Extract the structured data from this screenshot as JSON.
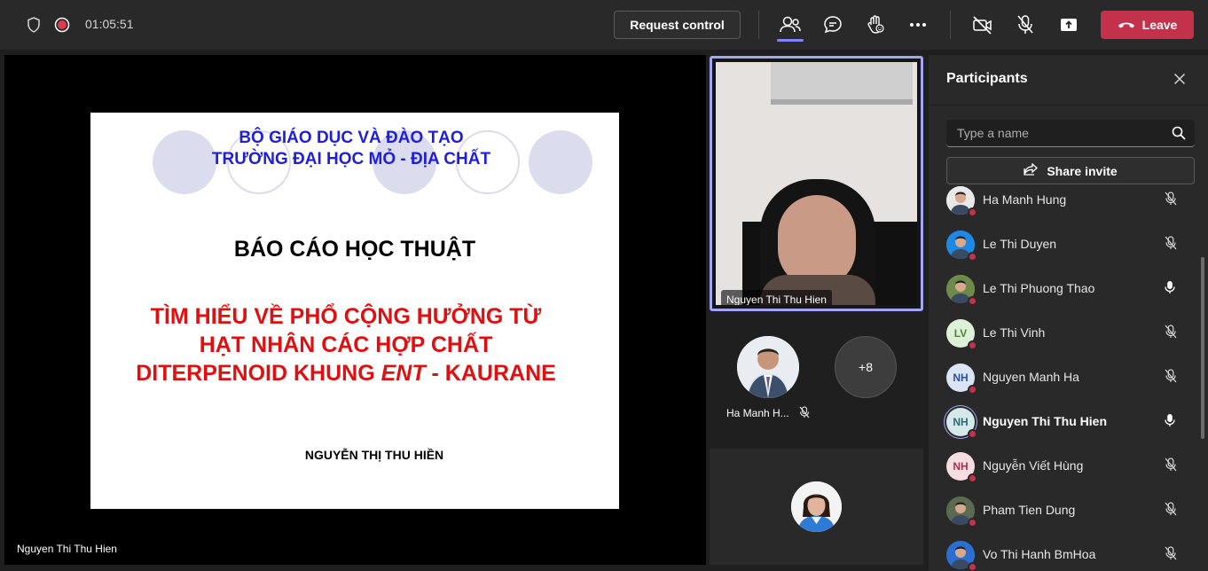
{
  "topbar": {
    "timer": "01:05:51",
    "request_control_label": "Request control",
    "leave_label": "Leave",
    "icons": [
      "shield-icon",
      "recording-icon",
      "people-icon",
      "chat-icon",
      "raise-hand-icon",
      "more-icon",
      "camera-off-icon",
      "mic-off-icon",
      "share-icon",
      "phone-icon"
    ]
  },
  "stage": {
    "presenter_name": "Nguyen Thi Thu Hien",
    "slide": {
      "institution_line1": "BỘ GIÁO DỤC VÀ ĐÀO TẠO",
      "institution_line2": "TRƯỜNG ĐẠI HỌC MỎ - ĐỊA CHẤT",
      "report_type": "BÁO CÁO HỌC THUẬT",
      "title_line1": "TÌM HIỂU VỀ PHỔ CỘNG HƯỞNG TỪ",
      "title_line2": "HẠT NHÂN CÁC HỢP CHẤT",
      "title_line3_pre": "DITERPENOID KHUNG ",
      "title_line3_italic": "ENT",
      "title_line3_post": " - KAURANE",
      "author": "NGUYỄN THỊ THU HIỀN"
    }
  },
  "video": {
    "speaker_name": "Nguyen Thi Thu Hien"
  },
  "tiles": {
    "participant_name": "Ha Manh H...",
    "more_count": "+8"
  },
  "panel": {
    "title": "Participants",
    "search_placeholder": "Type a name",
    "share_invite_label": "Share invite",
    "participants": [
      {
        "name": "Ha Manh Hung",
        "initials": "",
        "photo": true,
        "mic": "muted",
        "avatar_color": "#e8e8e8",
        "selected": false
      },
      {
        "name": "Le Thi Duyen",
        "initials": "",
        "photo": true,
        "mic": "muted",
        "avatar_color": "#1e88e5",
        "selected": false
      },
      {
        "name": "Le Thi Phuong Thao",
        "initials": "",
        "photo": true,
        "mic": "on",
        "avatar_color": "#6d8a4a",
        "selected": false
      },
      {
        "name": "Le Thi Vinh",
        "initials": "LV",
        "photo": false,
        "mic": "muted",
        "avatar_color": "#dff0d8",
        "text_color": "#4a8a2a",
        "selected": false
      },
      {
        "name": "Nguyen Manh Ha",
        "initials": "NH",
        "photo": false,
        "mic": "muted",
        "avatar_color": "#dbe4f5",
        "text_color": "#2c4f9e",
        "selected": false
      },
      {
        "name": "Nguyen Thi Thu Hien",
        "initials": "NH",
        "photo": false,
        "mic": "on",
        "avatar_color": "#d5e8ea",
        "text_color": "#2a6a75",
        "selected": true
      },
      {
        "name": "Nguyễn Viết Hùng",
        "initials": "NH",
        "photo": false,
        "mic": "muted",
        "avatar_color": "#f6dde2",
        "text_color": "#a8334e",
        "selected": false
      },
      {
        "name": "Pham Tien Dung",
        "initials": "",
        "photo": true,
        "mic": "muted",
        "avatar_color": "#5d6a52",
        "selected": false
      },
      {
        "name": "Vo Thi Hanh BmHoa",
        "initials": "",
        "photo": true,
        "mic": "muted",
        "avatar_color": "#2d6fd1",
        "selected": false
      }
    ]
  },
  "colors": {
    "accent": "#7f85f5",
    "leave": "#c4314b",
    "slide_blue": "#1f1fd8",
    "slide_red": "#e01010"
  }
}
